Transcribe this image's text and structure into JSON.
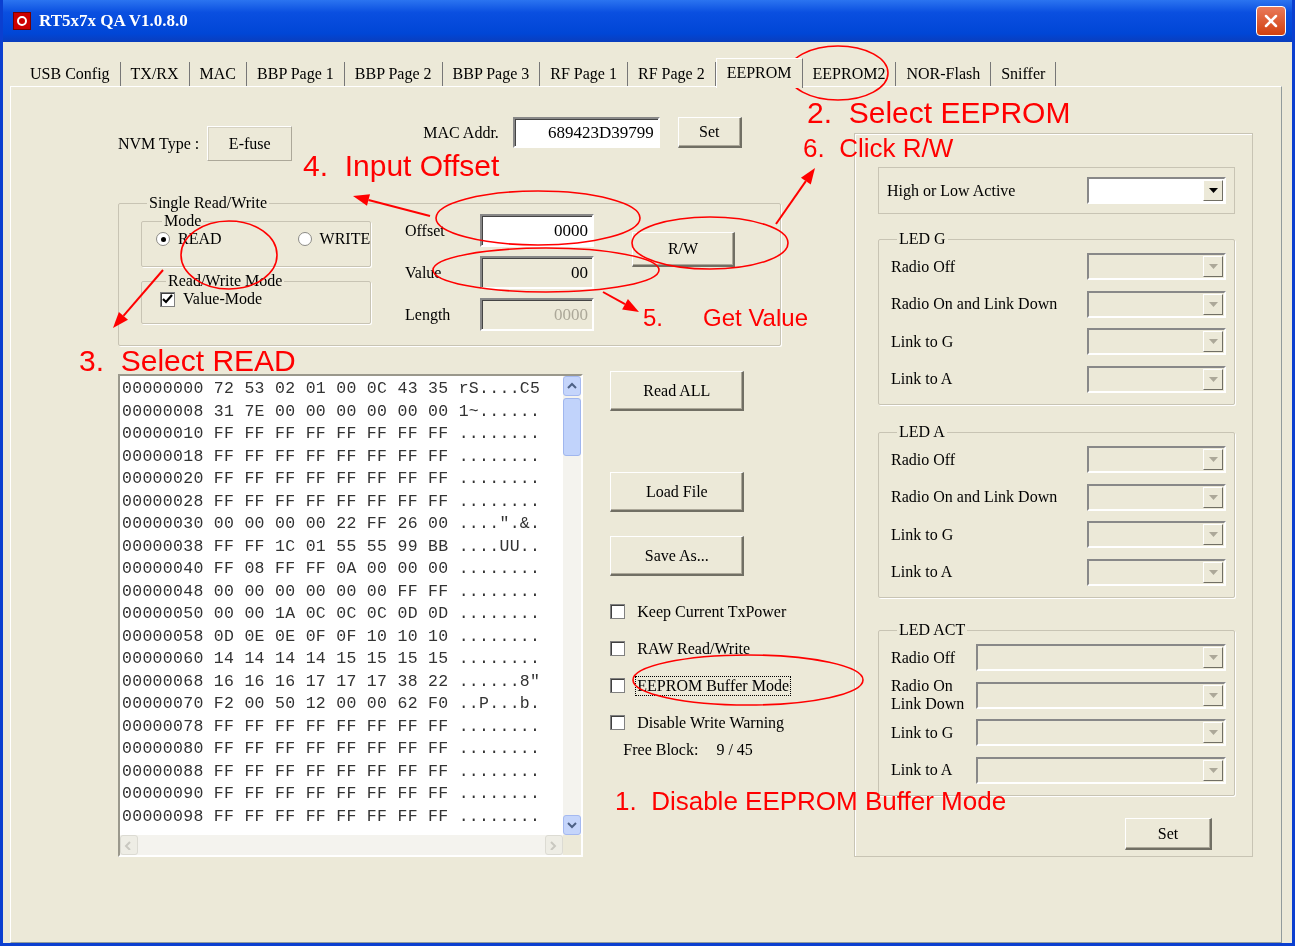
{
  "window": {
    "title": "RT5x7x QA V1.0.8.0"
  },
  "tabs": [
    {
      "label": "USB Config",
      "selected": false
    },
    {
      "label": "TX/RX",
      "selected": false
    },
    {
      "label": "MAC",
      "selected": false
    },
    {
      "label": "BBP Page 1",
      "selected": false
    },
    {
      "label": "BBP Page 2",
      "selected": false
    },
    {
      "label": "BBP Page 3",
      "selected": false
    },
    {
      "label": "RF Page 1",
      "selected": false
    },
    {
      "label": "RF Page 2",
      "selected": false
    },
    {
      "label": "EEPROM",
      "selected": true
    },
    {
      "label": "EEPROM2",
      "selected": false
    },
    {
      "label": "NOR-Flash",
      "selected": false
    },
    {
      "label": "Sniffer",
      "selected": false
    }
  ],
  "nvm": {
    "label": "NVM Type :",
    "value": "E-fuse"
  },
  "mac": {
    "label": "MAC Addr.",
    "value": "689423D39799",
    "button": "Set"
  },
  "single_rw": {
    "title": "Single Read/Write",
    "mode": {
      "title": "Mode",
      "options": [
        {
          "label": "READ",
          "selected": true
        },
        {
          "label": "WRITE",
          "selected": false
        }
      ]
    },
    "rw_mode": {
      "title": "Read/Write Mode",
      "checkbox": {
        "label": "Value-Mode",
        "checked": true
      }
    },
    "fields": [
      {
        "label": "Offset",
        "value": "0000",
        "kind": "editable"
      },
      {
        "label": "Value",
        "value": "00",
        "kind": "readonly"
      },
      {
        "label": "Length",
        "value": "0000",
        "kind": "disabled"
      }
    ],
    "button": "R/W"
  },
  "hex_dump": [
    "00000000 72 53 02 01 00 0C 43 35 rS....C5",
    "00000008 31 7E 00 00 00 00 00 00 1~......",
    "00000010 FF FF FF FF FF FF FF FF ........",
    "00000018 FF FF FF FF FF FF FF FF ........",
    "00000020 FF FF FF FF FF FF FF FF ........",
    "00000028 FF FF FF FF FF FF FF FF ........",
    "00000030 00 00 00 00 22 FF 26 00 ....\".&.",
    "00000038 FF FF 1C 01 55 55 99 BB ....UU..",
    "00000040 FF 08 FF FF 0A 00 00 00 ........",
    "00000048 00 00 00 00 00 00 FF FF ........",
    "00000050 00 00 1A 0C 0C 0C 0D 0D ........",
    "00000058 0D 0E 0E 0F 0F 10 10 10 ........",
    "00000060 14 14 14 14 15 15 15 15 ........",
    "00000068 16 16 16 17 17 17 38 22 ......8\"",
    "00000070 F2 00 50 12 00 00 62 F0 ..P...b.",
    "00000078 FF FF FF FF FF FF FF FF ........",
    "00000080 FF FF FF FF FF FF FF FF ........",
    "00000088 FF FF FF FF FF FF FF FF ........",
    "00000090 FF FF FF FF FF FF FF FF ........",
    "00000098 FF FF FF FF FF FF FF FF ........"
  ],
  "file_buttons": [
    "Read ALL",
    "Load File",
    "Save As..."
  ],
  "options": [
    {
      "label": "Keep Current TxPower",
      "checked": false,
      "focused": false
    },
    {
      "label": "RAW Read/Write",
      "checked": false,
      "focused": false
    },
    {
      "label": "EEPROM Buffer Mode",
      "checked": false,
      "focused": true
    },
    {
      "label": "Disable Write Warning",
      "checked": false,
      "focused": false
    }
  ],
  "free_block": {
    "label": "Free Block:",
    "value": "9 / 45"
  },
  "led_panel": {
    "high_low": {
      "label": "High or Low Active",
      "disabled": false
    },
    "groups": [
      {
        "title": "LED G",
        "kind": "standard",
        "rows": [
          {
            "label": "Radio Off",
            "disabled": true
          },
          {
            "label": "Radio On and Link Down",
            "disabled": true
          },
          {
            "label": "Link to G",
            "disabled": true
          },
          {
            "label": "Link to A",
            "disabled": true
          }
        ]
      },
      {
        "title": "LED A",
        "kind": "standard",
        "rows": [
          {
            "label": "Radio Off",
            "disabled": true
          },
          {
            "label": "Radio On and Link Down",
            "disabled": true
          },
          {
            "label": "Link to G",
            "disabled": true
          },
          {
            "label": "Link to A",
            "disabled": true
          }
        ]
      },
      {
        "title": "LED ACT",
        "kind": "compact",
        "rows": [
          {
            "label": "Radio Off",
            "disabled": true
          },
          {
            "label": "Radio On\nLink Down",
            "disabled": true
          },
          {
            "label": "Link to G",
            "disabled": true
          },
          {
            "label": "Link to A",
            "disabled": true
          }
        ]
      }
    ],
    "button": "Set"
  },
  "annotations": [
    "2.  Select EEPROM",
    "4.  Input Offset",
    "6.  Click R/W",
    "5.      Get Value",
    "3.  Select READ",
    "1.  Disable EEPROM Buffer Mode"
  ]
}
